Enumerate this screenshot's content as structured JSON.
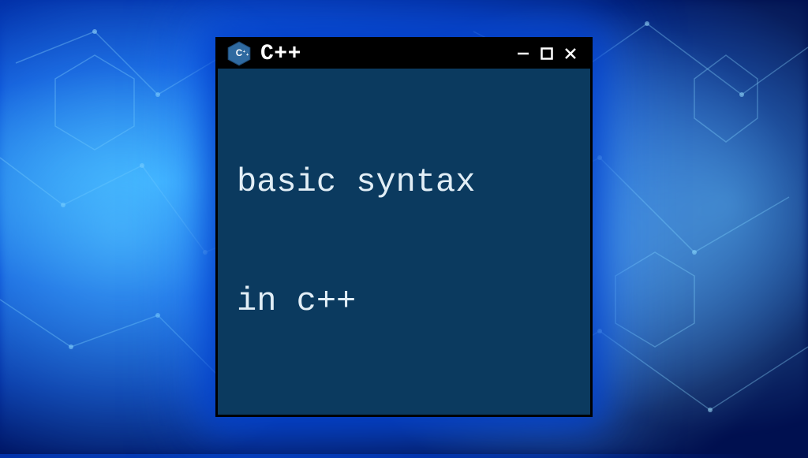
{
  "window": {
    "title": "C++",
    "icon": "cpp-logo-icon",
    "controls": {
      "minimize": "−",
      "maximize": "□",
      "close": "×"
    },
    "content": {
      "line1": "basic syntax",
      "line2": "in c++"
    },
    "colors": {
      "titlebar_bg": "#000000",
      "body_bg": "#0b3a5f",
      "text": "#e2eef6",
      "logo_fill": "#2f6aa0",
      "logo_stroke": "#1d4a75"
    }
  }
}
